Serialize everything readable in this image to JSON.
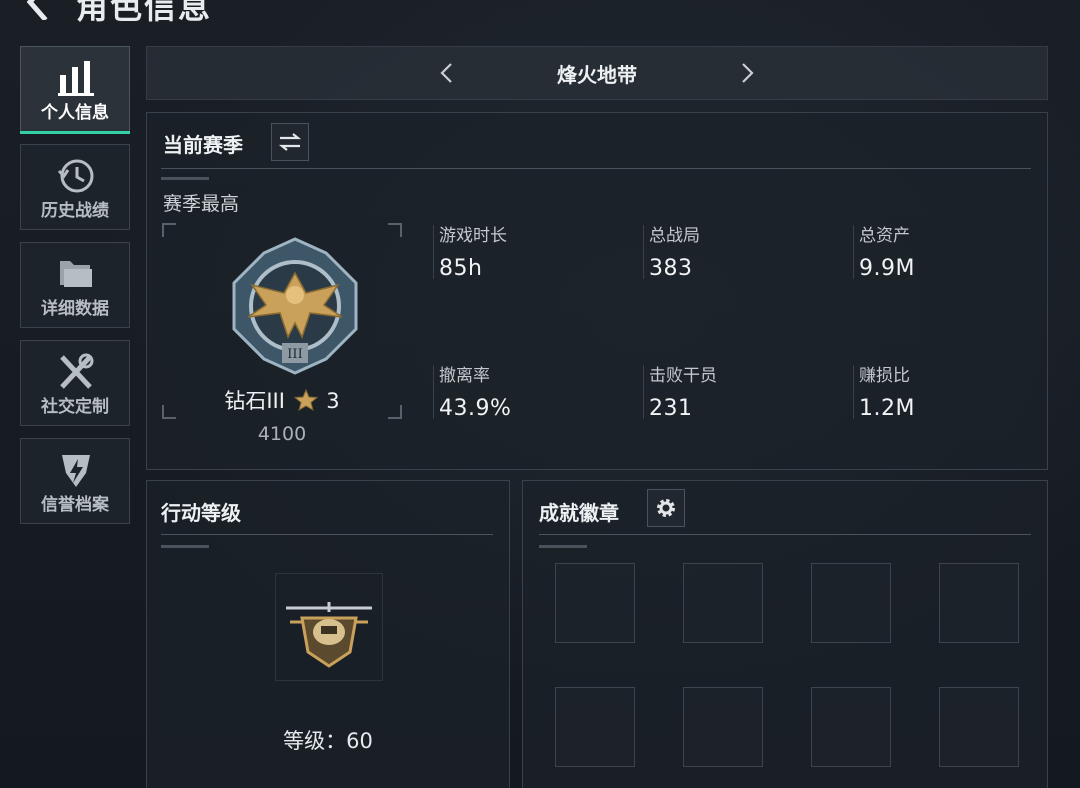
{
  "header": {
    "title": "角色信息"
  },
  "sidebar": {
    "items": [
      {
        "label": "个人信息",
        "icon": "bar-chart-icon",
        "active": true
      },
      {
        "label": "历史战绩",
        "icon": "history-clock-icon",
        "active": false
      },
      {
        "label": "详细数据",
        "icon": "folder-icon",
        "active": false
      },
      {
        "label": "社交定制",
        "icon": "tools-icon",
        "active": false
      },
      {
        "label": "信誉档案",
        "icon": "shield-badge-icon",
        "active": false
      }
    ]
  },
  "map_selector": {
    "name": "烽火地带"
  },
  "season": {
    "title": "当前赛季",
    "subheading": "赛季最高",
    "rank": {
      "name": "钻石III",
      "stars": "3",
      "score": "4100"
    },
    "stats": [
      {
        "label": "游戏时长",
        "value": "85h"
      },
      {
        "label": "总战局",
        "value": "383"
      },
      {
        "label": "总资产",
        "value": "9.9M"
      },
      {
        "label": "撤离率",
        "value": "43.9%"
      },
      {
        "label": "击败干员",
        "value": "231"
      },
      {
        "label": "赚损比",
        "value": "1.2M"
      }
    ]
  },
  "action_level": {
    "title": "行动等级",
    "level_text": "等级：60"
  },
  "achievements": {
    "title": "成就徽章",
    "slot_count": 8
  },
  "colors": {
    "accent": "#34d1a3",
    "gold": "#c9a15a",
    "background": "#161b22"
  }
}
